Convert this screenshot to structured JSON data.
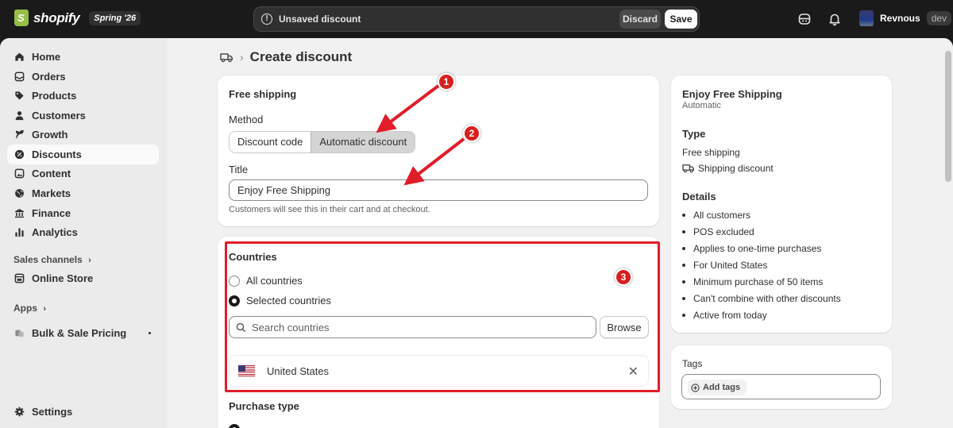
{
  "topbar": {
    "logo_text": "shopify",
    "edition": "Spring '26",
    "unsaved_icon_glyph": "!",
    "unsaved_text": "Unsaved discount",
    "discard_label": "Discard",
    "save_label": "Save",
    "user_name": "Revnous",
    "user_badge": "dev"
  },
  "sidebar": {
    "items": [
      {
        "label": "Home",
        "icon": "home-icon"
      },
      {
        "label": "Orders",
        "icon": "inbox-icon"
      },
      {
        "label": "Products",
        "icon": "tag-icon"
      },
      {
        "label": "Customers",
        "icon": "person-icon"
      },
      {
        "label": "Growth",
        "icon": "growth-icon"
      },
      {
        "label": "Discounts",
        "icon": "discount-icon",
        "active": true
      },
      {
        "label": "Content",
        "icon": "content-icon"
      },
      {
        "label": "Markets",
        "icon": "globe-icon"
      },
      {
        "label": "Finance",
        "icon": "bank-icon"
      },
      {
        "label": "Analytics",
        "icon": "chart-icon"
      }
    ],
    "sales_channels_heading": "Sales channels",
    "online_store_label": "Online Store",
    "apps_heading": "Apps",
    "bulk_pricing_label": "Bulk & Sale Pricing",
    "settings_label": "Settings"
  },
  "page": {
    "title": "Create discount",
    "separator": "›"
  },
  "discount_card": {
    "heading": "Free shipping",
    "method_label": "Method",
    "method_options": [
      "Discount code",
      "Automatic discount"
    ],
    "selected_method": "Automatic discount",
    "title_label": "Title",
    "title_value": "Enjoy Free Shipping",
    "title_help": "Customers will see this in their cart and at checkout."
  },
  "countries_card": {
    "heading": "Countries",
    "option_all": "All countries",
    "option_selected": "Selected countries",
    "search_placeholder": "Search countries",
    "browse_label": "Browse",
    "countries": [
      "United States"
    ],
    "remove_glyph": "✕",
    "next_heading": "Purchase type"
  },
  "summary": {
    "title": "Enjoy Free Shipping",
    "subtitle": "Automatic",
    "type_heading": "Type",
    "type_value": "Free shipping",
    "type_detail": "Shipping discount",
    "details_heading": "Details",
    "details": [
      "All customers",
      "POS excluded",
      "Applies to one-time purchases",
      "For United States",
      "Minimum purchase of 50 items",
      "Can't combine with other discounts",
      "Active from today"
    ]
  },
  "tags": {
    "heading": "Tags",
    "add_label": "Add tags"
  },
  "callouts": [
    "1",
    "2",
    "3"
  ],
  "colors": {
    "annotation_red": "#e11d2a",
    "topbar_bg": "#1a1a1a",
    "page_bg": "#f1f1f1"
  }
}
